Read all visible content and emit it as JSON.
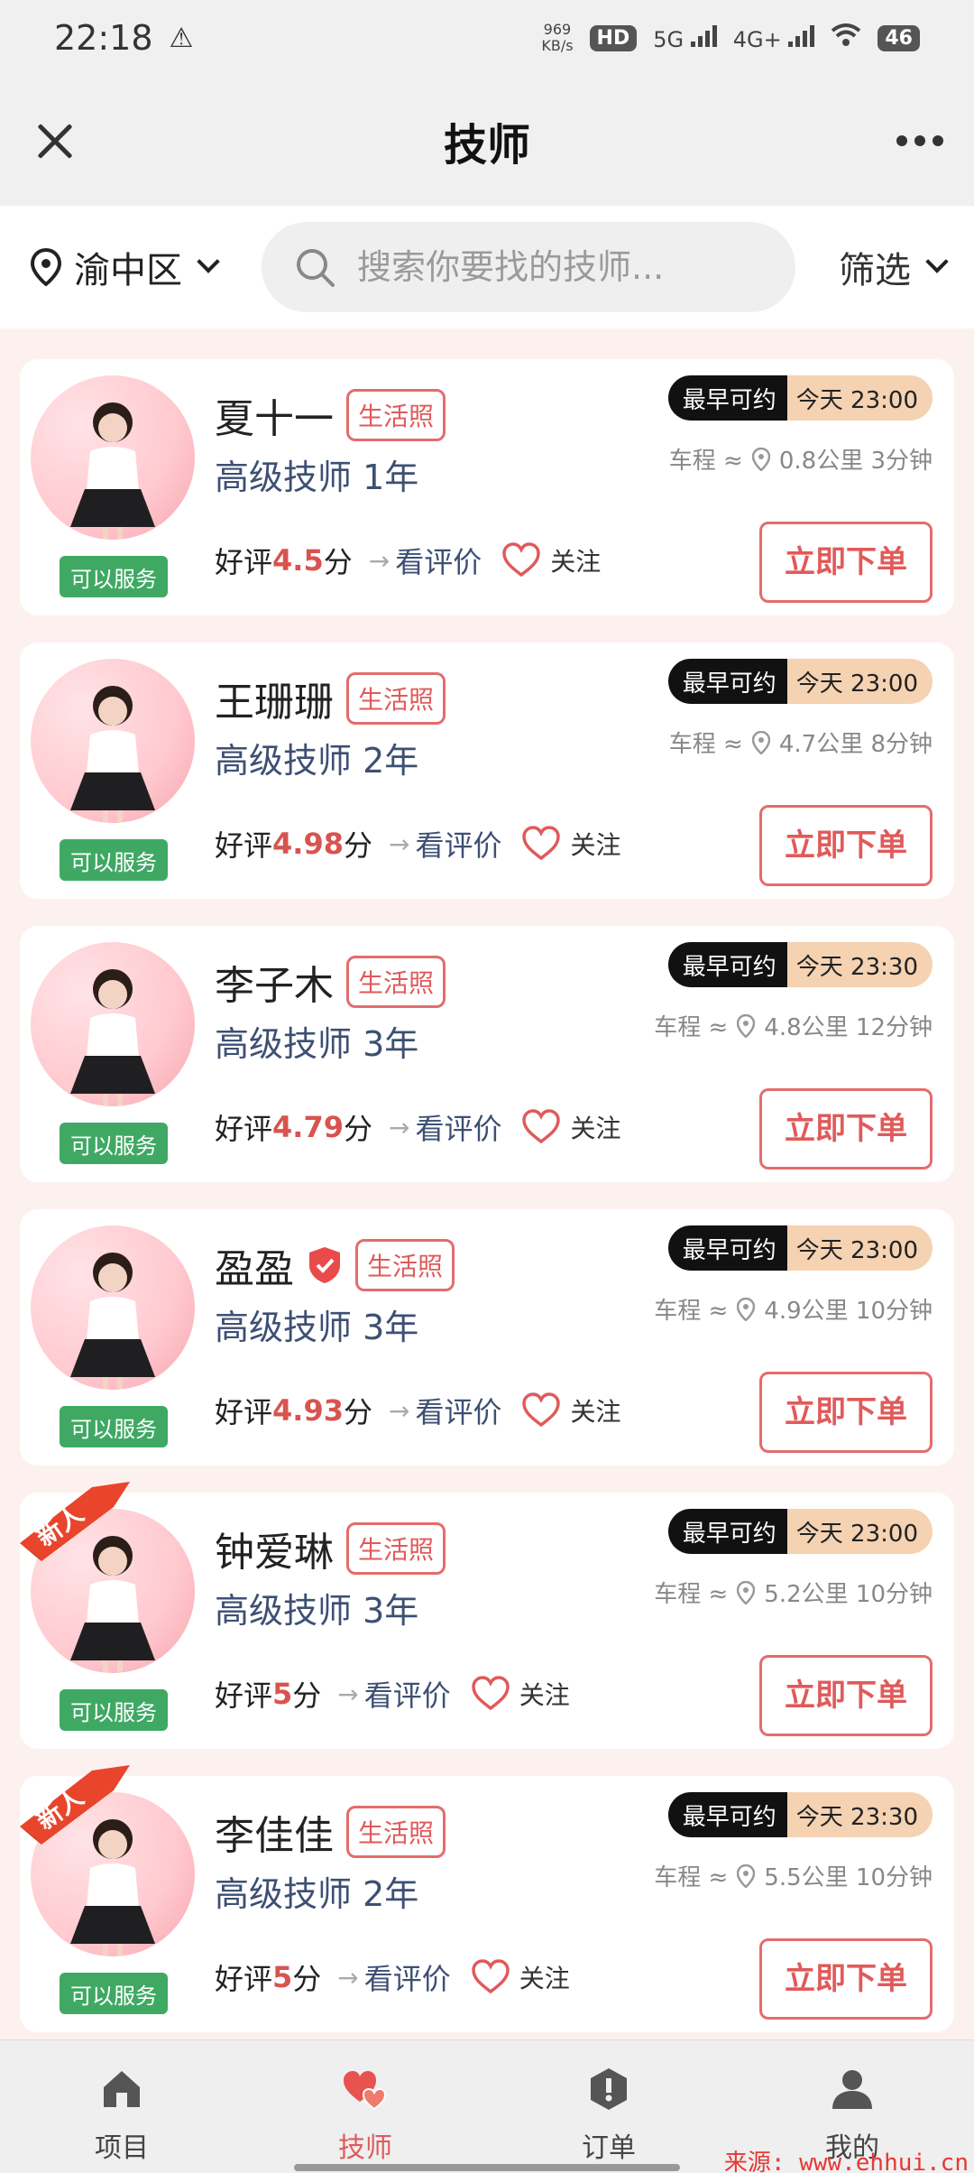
{
  "status_bar": {
    "time": "22:18",
    "net_speed_value": "969",
    "net_speed_unit": "KB/s",
    "hd_label": "HD",
    "signal_5g": "5G",
    "signal_4g": "4G+",
    "battery": "46"
  },
  "header": {
    "title": "技师"
  },
  "filter": {
    "location": "渝中区",
    "search_placeholder": "搜索你要找的技师...",
    "filter_label": "筛选"
  },
  "common": {
    "service_status": "可以服务",
    "life_photo": "生活照",
    "avail_label": "最早可约",
    "rating_prefix": "好评",
    "rating_suffix": "分",
    "review_link": "看评价",
    "follow": "关注",
    "order_button": "立即下单",
    "distance_prefix": "车程 ≈",
    "new_badge": "新人"
  },
  "technicians": [
    {
      "name": "夏十一",
      "level": "高级技师 1年",
      "avail_time": "今天 23:00",
      "distance": "0.8公里 3分钟",
      "rating": "4.5",
      "is_new": false,
      "verified": false
    },
    {
      "name": "王珊珊",
      "level": "高级技师 2年",
      "avail_time": "今天 23:00",
      "distance": "4.7公里 8分钟",
      "rating": "4.98",
      "is_new": false,
      "verified": false
    },
    {
      "name": "李子木",
      "level": "高级技师 3年",
      "avail_time": "今天 23:30",
      "distance": "4.8公里 12分钟",
      "rating": "4.79",
      "is_new": false,
      "verified": false
    },
    {
      "name": "盈盈",
      "level": "高级技师 3年",
      "avail_time": "今天 23:00",
      "distance": "4.9公里 10分钟",
      "rating": "4.93",
      "is_new": false,
      "verified": true
    },
    {
      "name": "钟爱琳",
      "level": "高级技师 3年",
      "avail_time": "今天 23:00",
      "distance": "5.2公里 10分钟",
      "rating": "5",
      "is_new": true,
      "verified": false
    },
    {
      "name": "李佳佳",
      "level": "高级技师 2年",
      "avail_time": "今天 23:30",
      "distance": "5.5公里 10分钟",
      "rating": "5",
      "is_new": true,
      "verified": false
    }
  ],
  "tabs": [
    {
      "label": "项目",
      "icon": "home-icon",
      "active": false
    },
    {
      "label": "技师",
      "icon": "hearts-icon",
      "active": true
    },
    {
      "label": "订单",
      "icon": "order-icon",
      "active": false
    },
    {
      "label": "我的",
      "icon": "user-icon",
      "active": false
    }
  ],
  "watermark": "来源: www.ehhui.cn",
  "colors": {
    "accent_red": "#e05a5a",
    "service_green": "#3fa963",
    "level_blue": "#3d5073",
    "avail_tan": "#f4d2b2"
  }
}
